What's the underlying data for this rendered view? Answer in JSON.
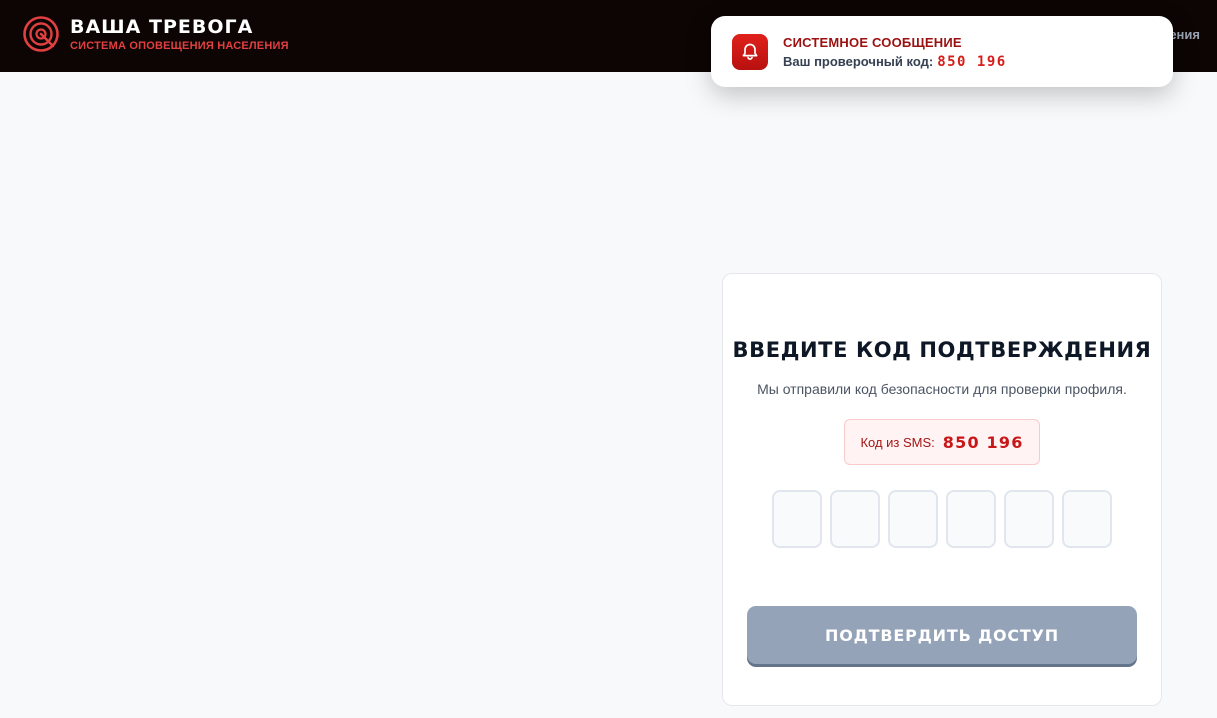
{
  "header": {
    "title": "ВАША ТРЕВОГА",
    "subtitle": "СИСТЕМА ОПОВЕЩЕНИЯ НАСЕЛЕНИЯ",
    "nav_partial": "ения"
  },
  "toast": {
    "title": "СИСТЕМНОЕ СООБЩЕНИЕ",
    "text": "Ваш проверочный код:",
    "code": "850 196",
    "icon": "bell-icon"
  },
  "card": {
    "title": "ВВЕДИТЕ КОД ПОДТВЕРЖДЕНИЯ",
    "description": "Мы отправили код безопасности для проверки профиля.",
    "sms_label": "Код из SMS:",
    "sms_code": "850 196",
    "otp_digits": [
      "",
      "",
      "",
      "",
      "",
      ""
    ],
    "submit_label": "ПОДТВЕРДИТЬ ДОСТУП"
  },
  "colors": {
    "header_bg": "#0d0404",
    "accent_red": "#d71d1a",
    "button_disabled": "#94a3b8"
  }
}
